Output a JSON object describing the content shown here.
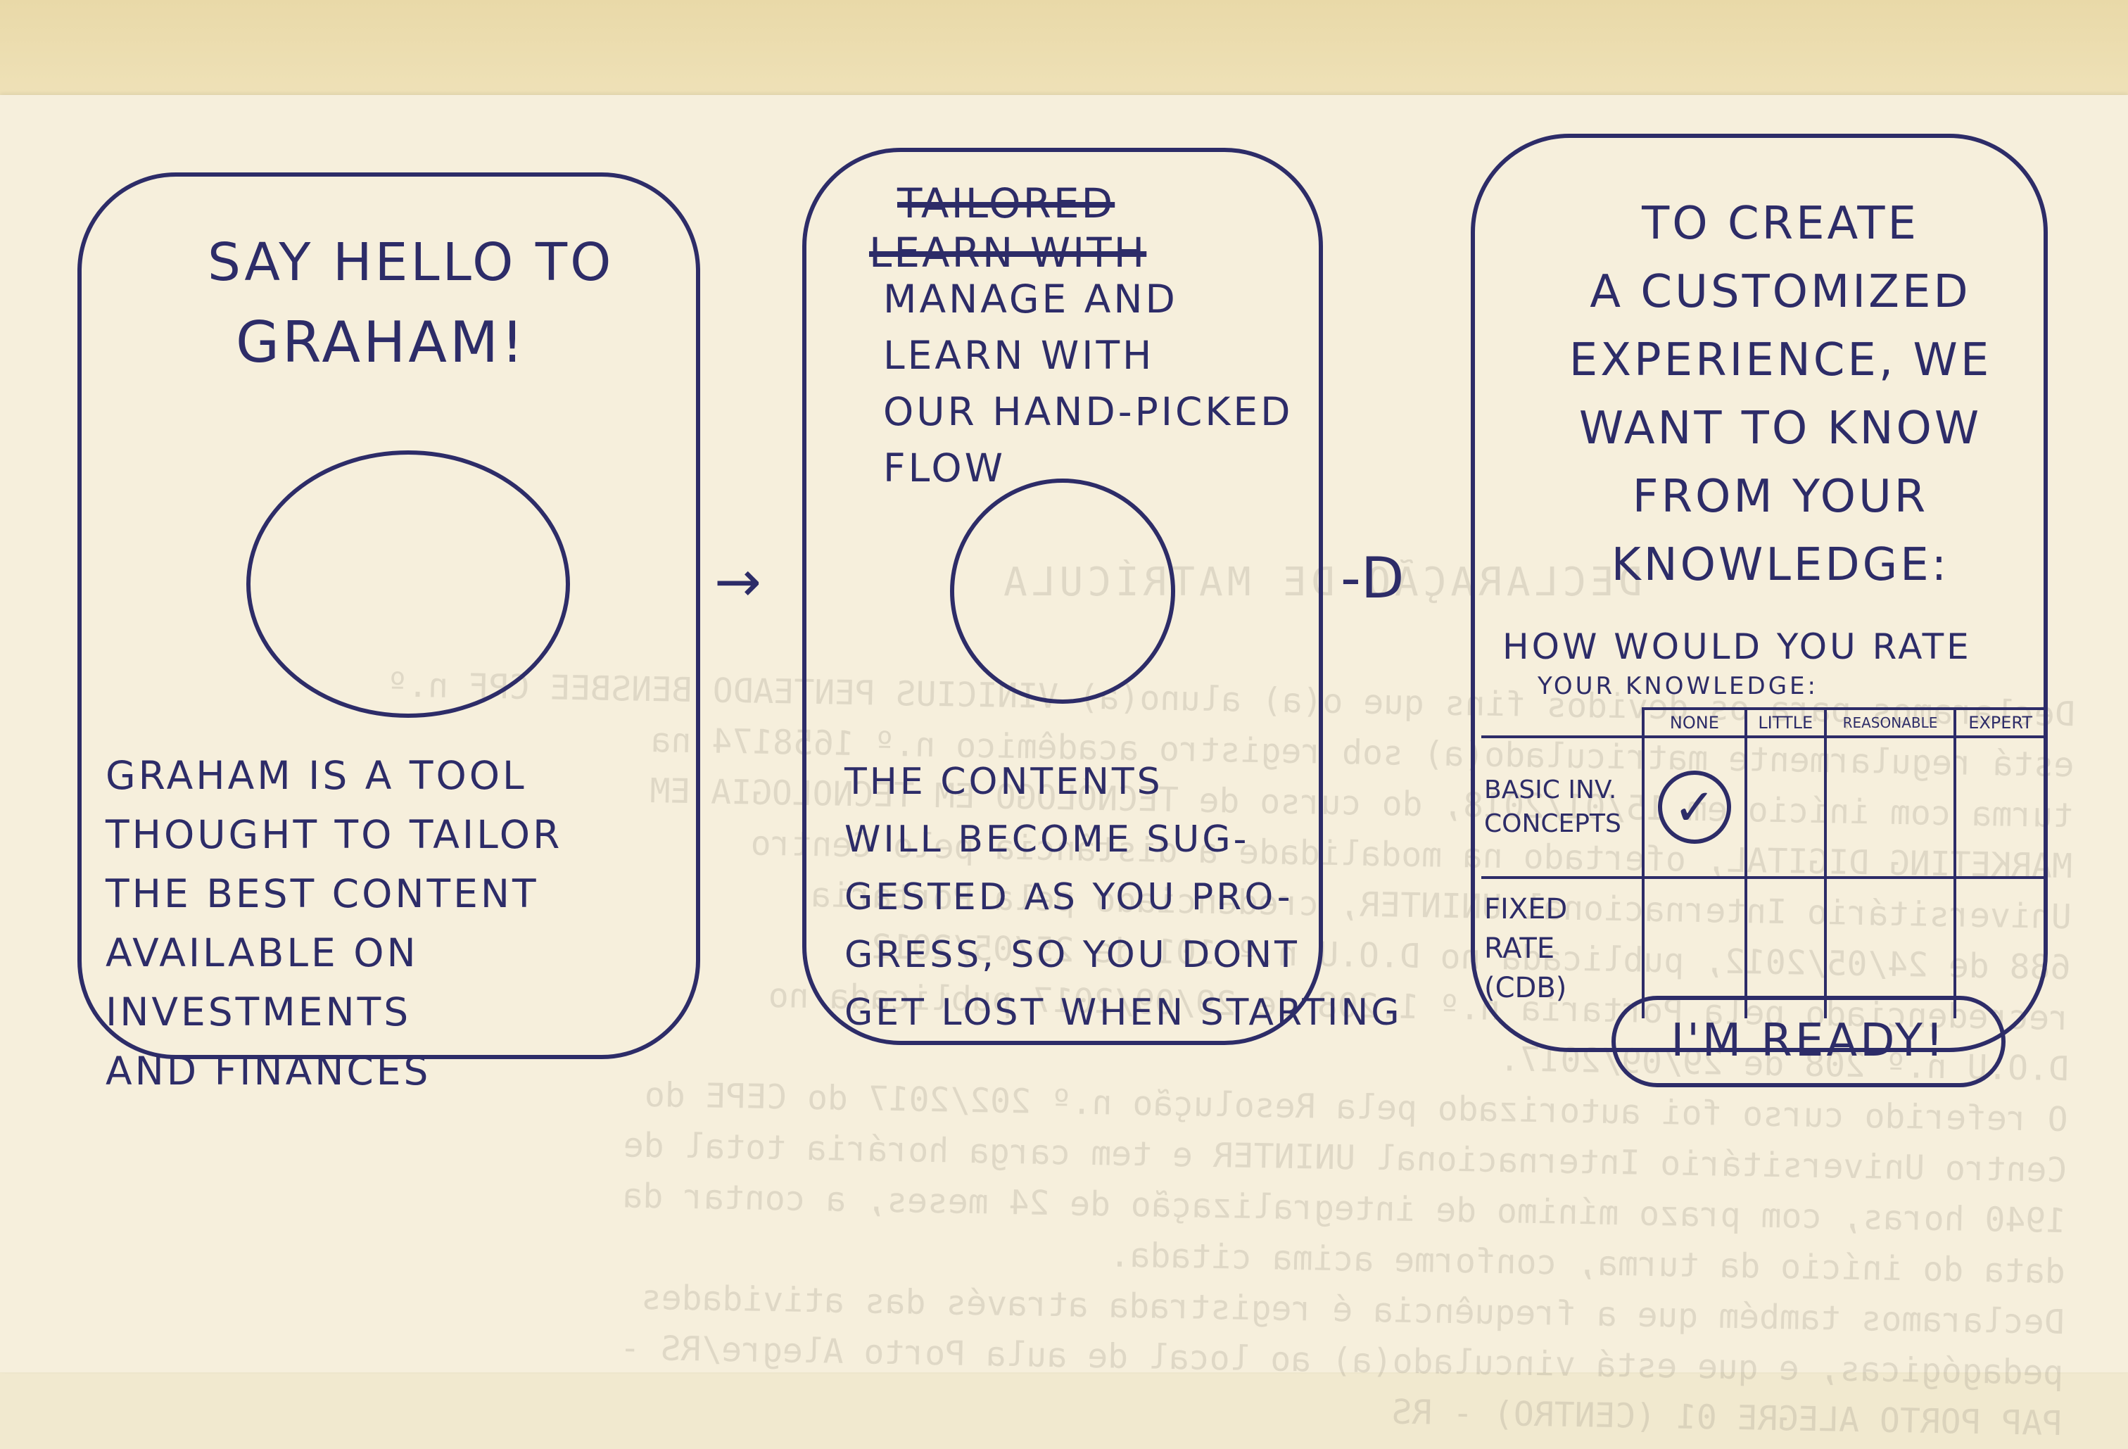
{
  "screen1": {
    "title_line1": "SAY HELLO TO",
    "title_line2": "GRAHAM!",
    "body": "GRAHAM IS A TOOL\nTHOUGHT TO TAILOR\nTHE BEST CONTENT\nAVAILABLE ON INVESTMENTS\nAND FINANCES"
  },
  "screen2": {
    "crossed_out_line1": "TAILORED",
    "crossed_out_line2": "LEARN WITH",
    "title": "MANAGE AND\nLEARN WITH\nOUR HAND-PICKED FLOW",
    "body": "THE CONTENTS\nWILL BECOME SUG-\nGESTED AS YOU PRO-\nGRESS, SO YOU DONT\nGET LOST WHEN STARTING"
  },
  "screen3": {
    "title": "TO CREATE\nA CUSTOMIZED\nEXPERIENCE, WE\nWANT TO KNOW\nFROM YOUR\nKNOWLEDGE:",
    "table": {
      "question_line1": "HOW WOULD YOU RATE",
      "question_line2": "YOUR KNOWLEDGE:",
      "columns": [
        "NONE",
        "LITTLE",
        "REASONABLE",
        "EXPERT"
      ],
      "rows": [
        {
          "label": "BASIC INV. CONCEPTS",
          "checked": "NONE"
        },
        {
          "label": "FIXED RATE (CDB)",
          "checked": ""
        }
      ],
      "check_glyph": "✓"
    },
    "ready_button": "I'M READY!"
  },
  "arrows": {
    "glyph1": "→",
    "glyph2": "-D"
  },
  "paper_bleed": {
    "title": "DECLARAÇÃO DE MATRÍCULA",
    "lines": [
      "Declaramos para os devidos fins que o(a) aluno(a) VINICIUS PENTEADO BENSBEE CPF n.º",
      "está regularmente matriculado(a) sob registro acadêmico n.º 1658174 na",
      "turma com início em 15/01/2018, do curso de TECNÓLOGO EM TECNOLOGIA EM",
      "MARKETING DIGITAL, ofertado na modalidade a distância pelo Centro",
      "Universitário Internacional UNINTER, credenciado pela Portaria",
      "688 de 24/05/2012, publicada no D.O.U n.º 101 de 25/05/2012",
      "recredenciado pela Portaria n.º 1.208 de 29/09/2017 publicada no",
      "D.O.U n.º 208 de 29/09/2017.",
      "O referido curso foi autorizado pela Resolução n.º 202/2017 do CEPE do",
      "Centro Universitário Internacional UNINTER e tem carga horária total de",
      "1940 horas, com prazo mínimo de integralização de 24 meses, a contar da",
      "data do início da turma, conforme acima citada.",
      "Declaramos também que a frequência é registrada através das atividades",
      "pedagógicas, e que está vinculado(a) ao local de aula Porto Alegre/RS -",
      "PAP PORTO ALEGRE 01 (CENTRO) - RS"
    ]
  }
}
